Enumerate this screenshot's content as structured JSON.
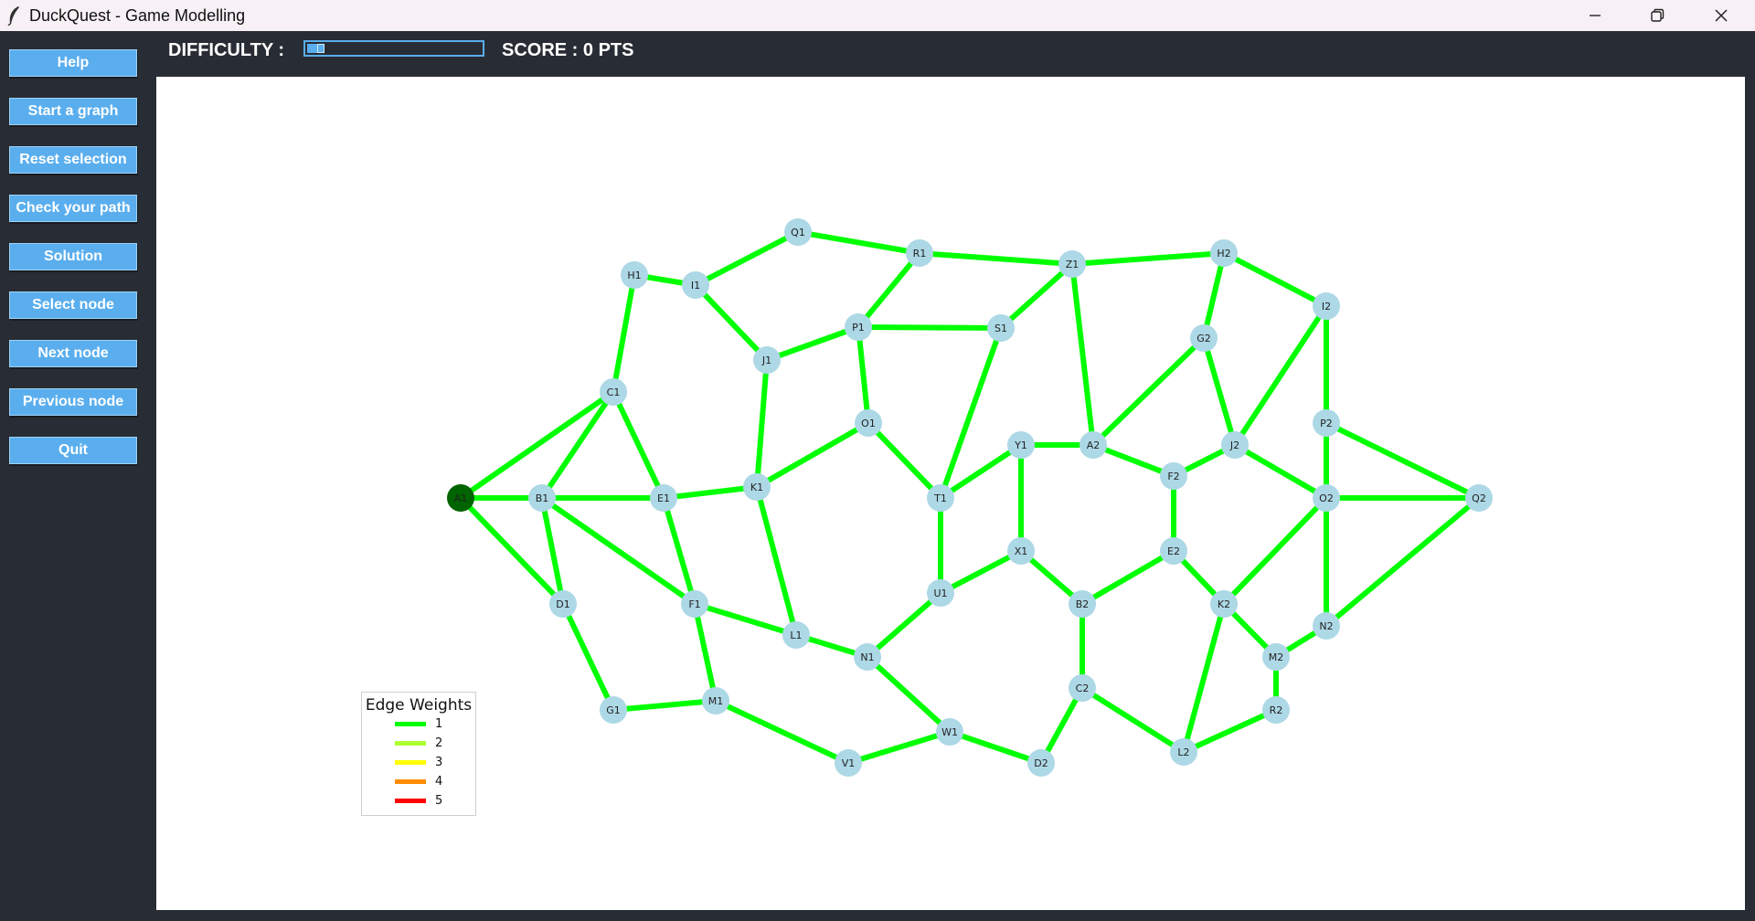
{
  "window": {
    "title": "DuckQuest - Game Modelling"
  },
  "sidebar": {
    "buttons": [
      "Help",
      "Start a graph",
      "Reset selection",
      "Check your path",
      "Solution",
      "Select node",
      "Next node",
      "Previous node",
      "Quit"
    ]
  },
  "topbar": {
    "difficulty_label": "DIFFICULTY :",
    "difficulty_level": 0.1,
    "score_label": "SCORE : 0 PTS"
  },
  "legend": {
    "title": "Edge Weights",
    "items": [
      {
        "label": "1",
        "color": "#00ff00"
      },
      {
        "label": "2",
        "color": "#adff2f"
      },
      {
        "label": "3",
        "color": "#ffff00"
      },
      {
        "label": "4",
        "color": "#ff8c00"
      },
      {
        "label": "5",
        "color": "#ff0000"
      }
    ]
  },
  "colors": {
    "edge": "#00ff00",
    "node": "#add8e6",
    "selected_node": "#006400",
    "button": "#5aaeee",
    "background": "#282c34"
  },
  "graph": {
    "selected_node": "A1",
    "nodes": [
      "A1",
      "B1",
      "C1",
      "D1",
      "E1",
      "F1",
      "G1",
      "H1",
      "I1",
      "J1",
      "K1",
      "L1",
      "M1",
      "N1",
      "O1",
      "P1",
      "Q1",
      "R1",
      "S1",
      "T1",
      "U1",
      "V1",
      "W1",
      "X1",
      "Y1",
      "Z1",
      "A2",
      "B2",
      "C2",
      "D2",
      "E2",
      "F2",
      "G2",
      "H2",
      "I2",
      "J2",
      "K2",
      "L2",
      "M2",
      "N2",
      "O2",
      "P2",
      "Q2",
      "R2"
    ],
    "edges": [
      [
        "A1",
        "B1",
        1
      ],
      [
        "A1",
        "C1",
        1
      ],
      [
        "A1",
        "D1",
        1
      ],
      [
        "B1",
        "C1",
        1
      ],
      [
        "B1",
        "E1",
        1
      ],
      [
        "B1",
        "D1",
        1
      ],
      [
        "B1",
        "F1",
        1
      ],
      [
        "C1",
        "H1",
        1
      ],
      [
        "C1",
        "E1",
        1
      ],
      [
        "D1",
        "G1",
        1
      ],
      [
        "G1",
        "M1",
        1
      ],
      [
        "E1",
        "K1",
        1
      ],
      [
        "E1",
        "F1",
        1
      ],
      [
        "F1",
        "M1",
        1
      ],
      [
        "F1",
        "L1",
        1
      ],
      [
        "H1",
        "I1",
        1
      ],
      [
        "I1",
        "Q1",
        1
      ],
      [
        "I1",
        "J1",
        1
      ],
      [
        "Q1",
        "R1",
        1
      ],
      [
        "R1",
        "Z1",
        1
      ],
      [
        "R1",
        "P1",
        1
      ],
      [
        "J1",
        "P1",
        1
      ],
      [
        "J1",
        "K1",
        1
      ],
      [
        "P1",
        "S1",
        1
      ],
      [
        "P1",
        "O1",
        1
      ],
      [
        "K1",
        "O1",
        1
      ],
      [
        "K1",
        "L1",
        1
      ],
      [
        "L1",
        "N1",
        1
      ],
      [
        "M1",
        "V1",
        1
      ],
      [
        "V1",
        "W1",
        1
      ],
      [
        "N1",
        "W1",
        1
      ],
      [
        "N1",
        "U1",
        1
      ],
      [
        "O1",
        "T1",
        1
      ],
      [
        "S1",
        "Z1",
        1
      ],
      [
        "S1",
        "T1",
        1
      ],
      [
        "T1",
        "Y1",
        1
      ],
      [
        "T1",
        "U1",
        1
      ],
      [
        "U1",
        "X1",
        1
      ],
      [
        "Y1",
        "X1",
        1
      ],
      [
        "Y1",
        "A2",
        1
      ],
      [
        "Z1",
        "H2",
        1
      ],
      [
        "Z1",
        "A2",
        1
      ],
      [
        "A2",
        "G2",
        1
      ],
      [
        "A2",
        "F2",
        1
      ],
      [
        "X1",
        "B2",
        1
      ],
      [
        "B2",
        "E2",
        1
      ],
      [
        "B2",
        "C2",
        1
      ],
      [
        "C2",
        "D2",
        1
      ],
      [
        "W1",
        "D2",
        1
      ],
      [
        "C2",
        "L2",
        1
      ],
      [
        "H2",
        "G2",
        1
      ],
      [
        "H2",
        "I2",
        1
      ],
      [
        "G2",
        "J2",
        1
      ],
      [
        "I2",
        "J2",
        1
      ],
      [
        "I2",
        "P2",
        1
      ],
      [
        "F2",
        "J2",
        1
      ],
      [
        "F2",
        "E2",
        1
      ],
      [
        "J2",
        "O2",
        1
      ],
      [
        "P2",
        "O2",
        1
      ],
      [
        "P2",
        "Q2",
        1
      ],
      [
        "O2",
        "Q2",
        1
      ],
      [
        "O2",
        "K2",
        1
      ],
      [
        "O2",
        "N2",
        1
      ],
      [
        "E2",
        "K2",
        1
      ],
      [
        "K2",
        "M2",
        1
      ],
      [
        "K2",
        "L2",
        1
      ],
      [
        "M2",
        "N2",
        1
      ],
      [
        "M2",
        "R2",
        1
      ],
      [
        "R2",
        "L2",
        1
      ],
      [
        "N2",
        "Q2",
        1
      ]
    ]
  }
}
